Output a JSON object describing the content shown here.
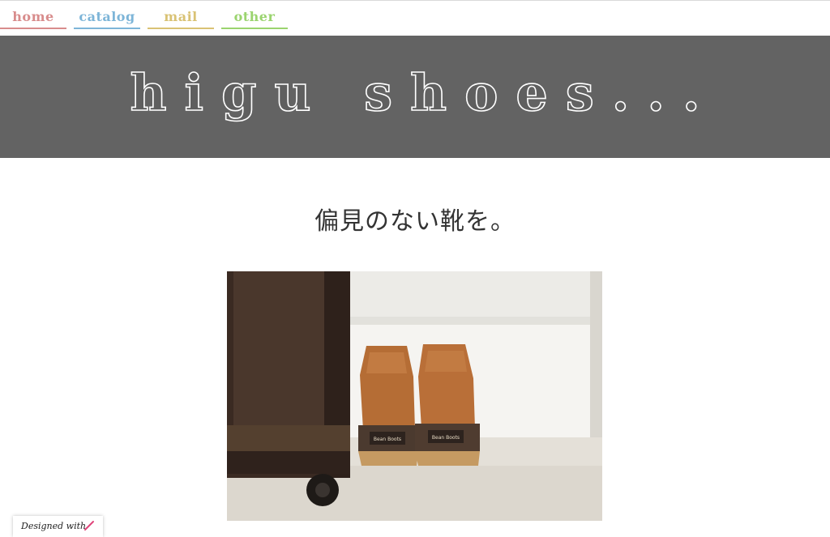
{
  "nav": {
    "items": [
      {
        "label": "home"
      },
      {
        "label": "catalog"
      },
      {
        "label": "mail"
      },
      {
        "label": "other"
      }
    ]
  },
  "header": {
    "title": "higu shoes..."
  },
  "main": {
    "tagline": "偏見のない靴を。",
    "hero_image": {
      "icon": "boots-photo",
      "label_left": "Bean Boots",
      "label_right": "Bean Boots"
    }
  },
  "footer": {
    "badge_text": "Designed with",
    "badge_icon": "pencil-icon"
  },
  "colors": {
    "banner": "#636363",
    "home": "#d88c8c",
    "catalog": "#7db5d8",
    "mail": "#d9c274",
    "other": "#9bd46f"
  }
}
